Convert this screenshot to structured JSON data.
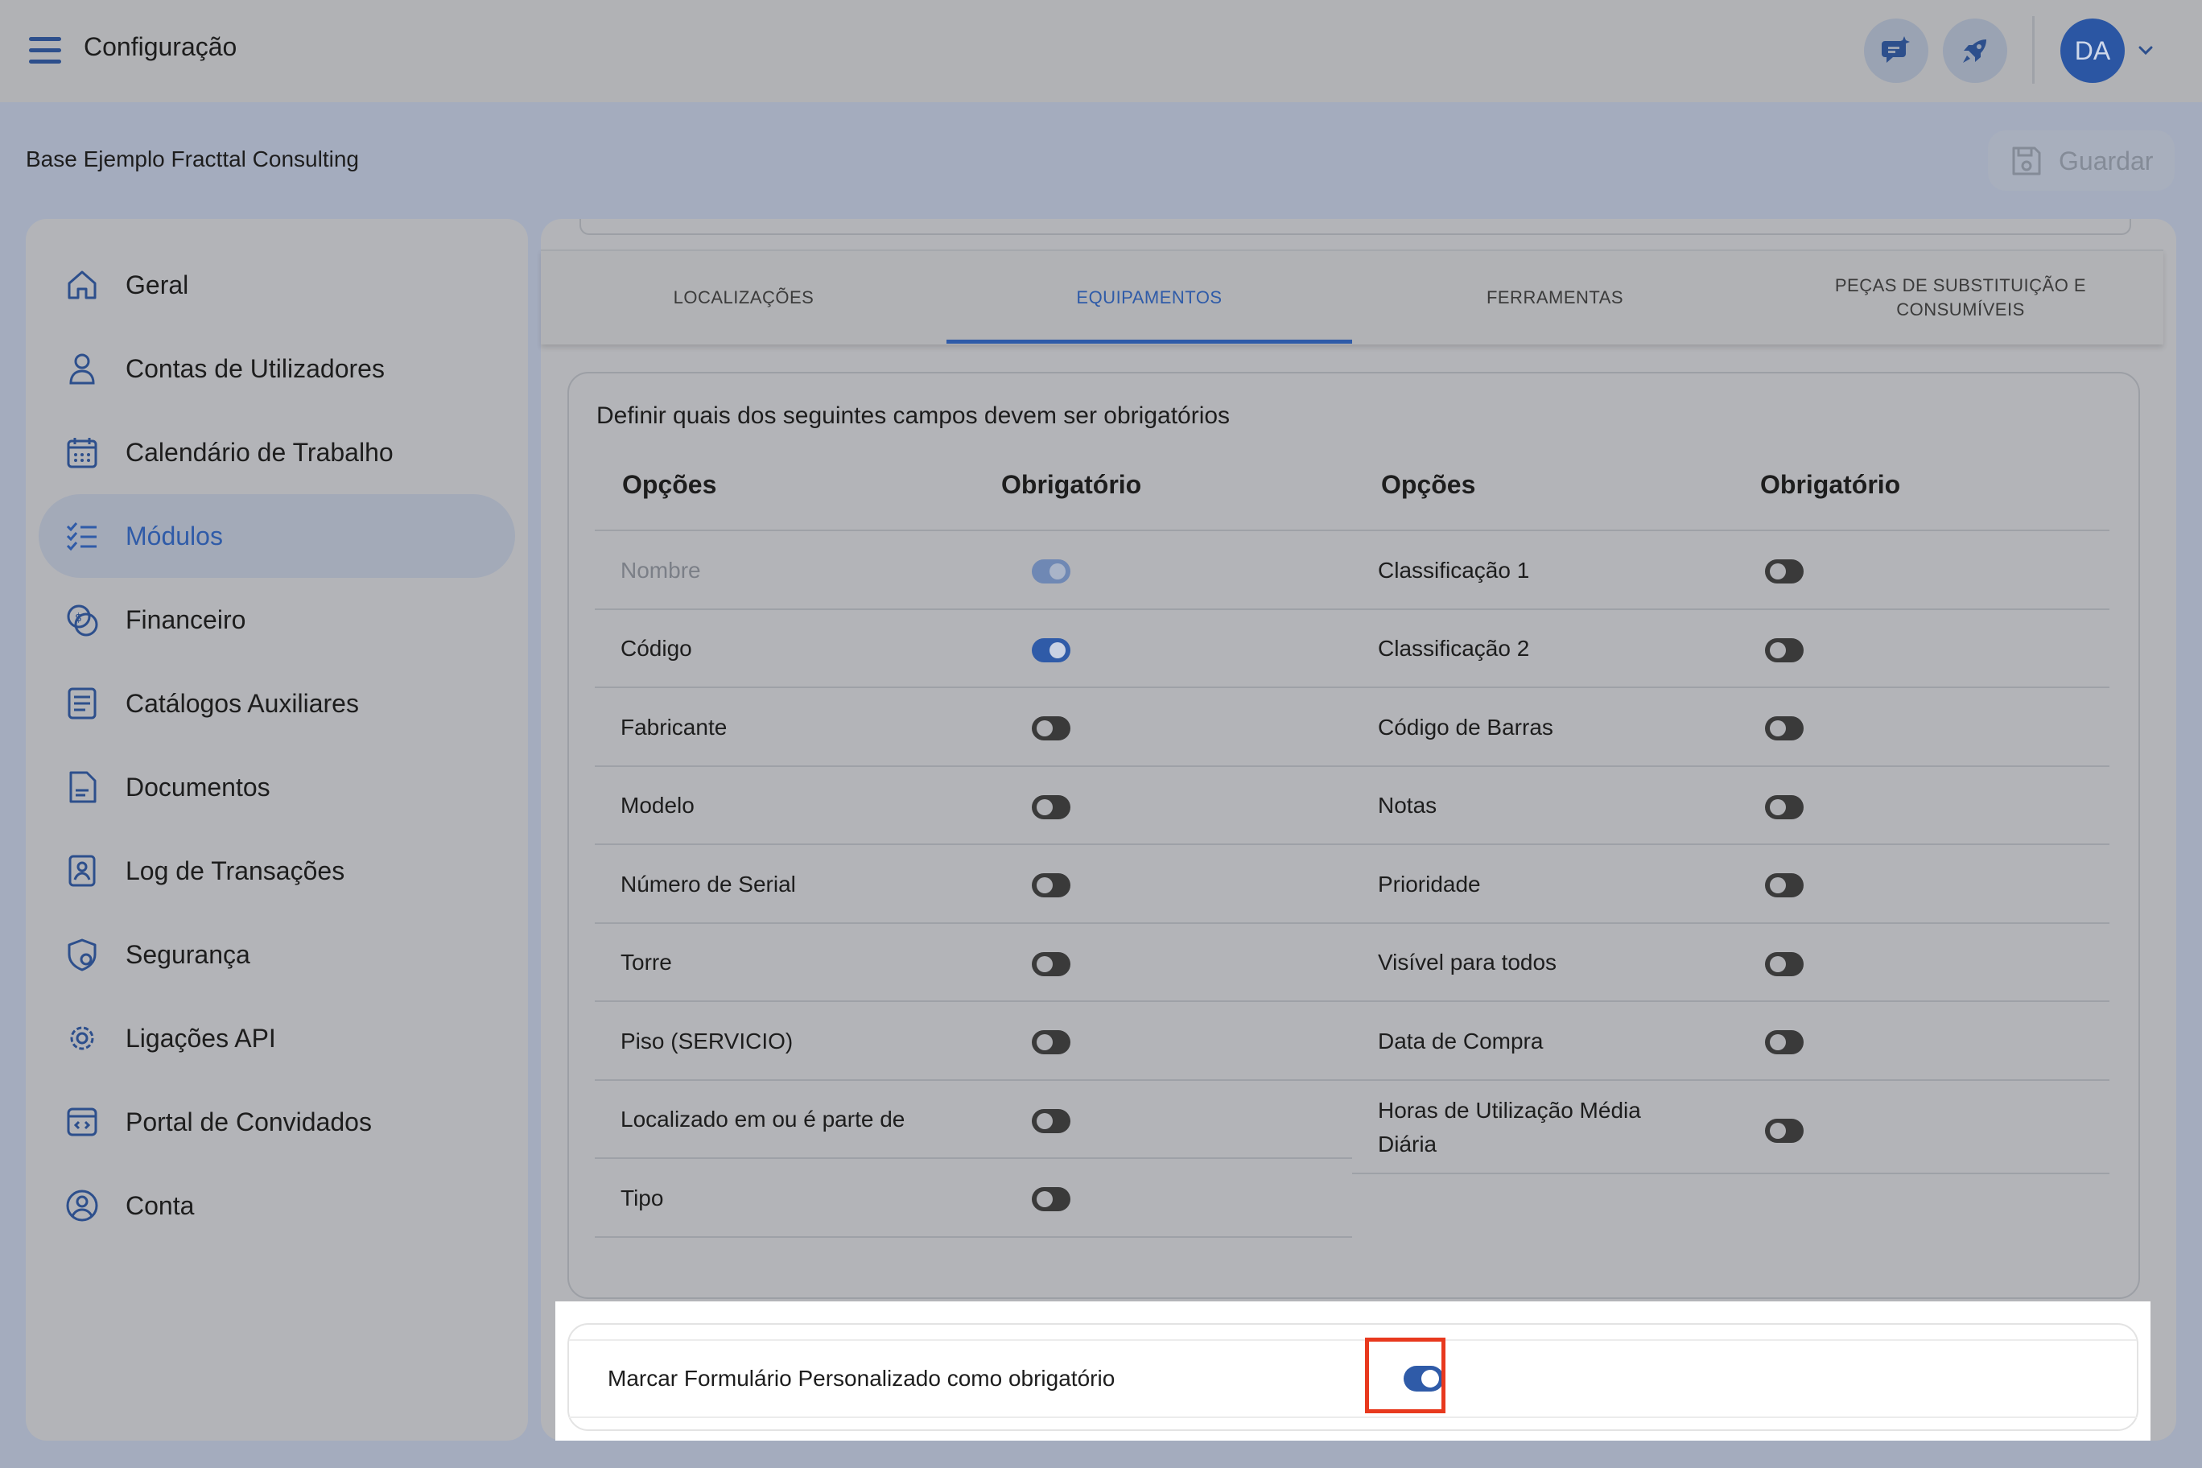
{
  "header": {
    "title": "Configuração",
    "avatar_initials": "DA"
  },
  "company": "Base Ejemplo Fracttal Consulting",
  "save_label": "Guardar",
  "sidebar": {
    "items": [
      {
        "label": "Geral",
        "icon": "home-icon"
      },
      {
        "label": "Contas de Utilizadores",
        "icon": "user-icon"
      },
      {
        "label": "Calendário de Trabalho",
        "icon": "calendar-icon"
      },
      {
        "label": "Módulos",
        "icon": "checklist-icon",
        "active": true
      },
      {
        "label": "Financeiro",
        "icon": "coins-icon"
      },
      {
        "label": "Catálogos Auxiliares",
        "icon": "catalog-icon"
      },
      {
        "label": "Documentos",
        "icon": "document-icon"
      },
      {
        "label": "Log de Transações",
        "icon": "log-icon"
      },
      {
        "label": "Segurança",
        "icon": "shield-icon"
      },
      {
        "label": "Ligações API",
        "icon": "api-gear-icon"
      },
      {
        "label": "Portal de Convidados",
        "icon": "portal-icon"
      },
      {
        "label": "Conta",
        "icon": "account-icon"
      }
    ]
  },
  "tabs": [
    {
      "label": "LOCALIZAÇÕES"
    },
    {
      "label": "EQUIPAMENTOS",
      "active": true
    },
    {
      "label": "FERRAMENTAS"
    },
    {
      "label": "PEÇAS DE SUBSTITUIÇÃO E CONSUMÍVEIS"
    }
  ],
  "fields": {
    "heading": "Definir quais dos seguintes campos devem ser obrigatórios",
    "col_options": "Opções",
    "col_required": "Obrigatório",
    "left": [
      {
        "name": "Nombre",
        "on": true,
        "disabled": true
      },
      {
        "name": "Código",
        "on": true
      },
      {
        "name": "Fabricante",
        "on": false
      },
      {
        "name": "Modelo",
        "on": false
      },
      {
        "name": "Número de Serial",
        "on": false
      },
      {
        "name": "Torre",
        "on": false
      },
      {
        "name": "Piso (SERVICIO)",
        "on": false
      },
      {
        "name": "Localizado em ou é parte de",
        "on": false
      },
      {
        "name": "Tipo",
        "on": false
      }
    ],
    "right": [
      {
        "name": "Classificação 1",
        "on": false
      },
      {
        "name": "Classificação 2",
        "on": false
      },
      {
        "name": "Código de Barras",
        "on": false
      },
      {
        "name": "Notas",
        "on": false
      },
      {
        "name": "Prioridade",
        "on": false
      },
      {
        "name": "Visível para todos",
        "on": false
      },
      {
        "name": "Data de Compra",
        "on": false
      },
      {
        "name": "Horas de Utilização Média Diária",
        "on": false
      }
    ]
  },
  "custom_form": {
    "label": "Marcar Formulário Personalizado como obrigatório",
    "on": true
  },
  "colors": {
    "accent": "#2f5ba8",
    "toggle_off": "#3a3a3a",
    "highlight_border": "#e8391e"
  }
}
